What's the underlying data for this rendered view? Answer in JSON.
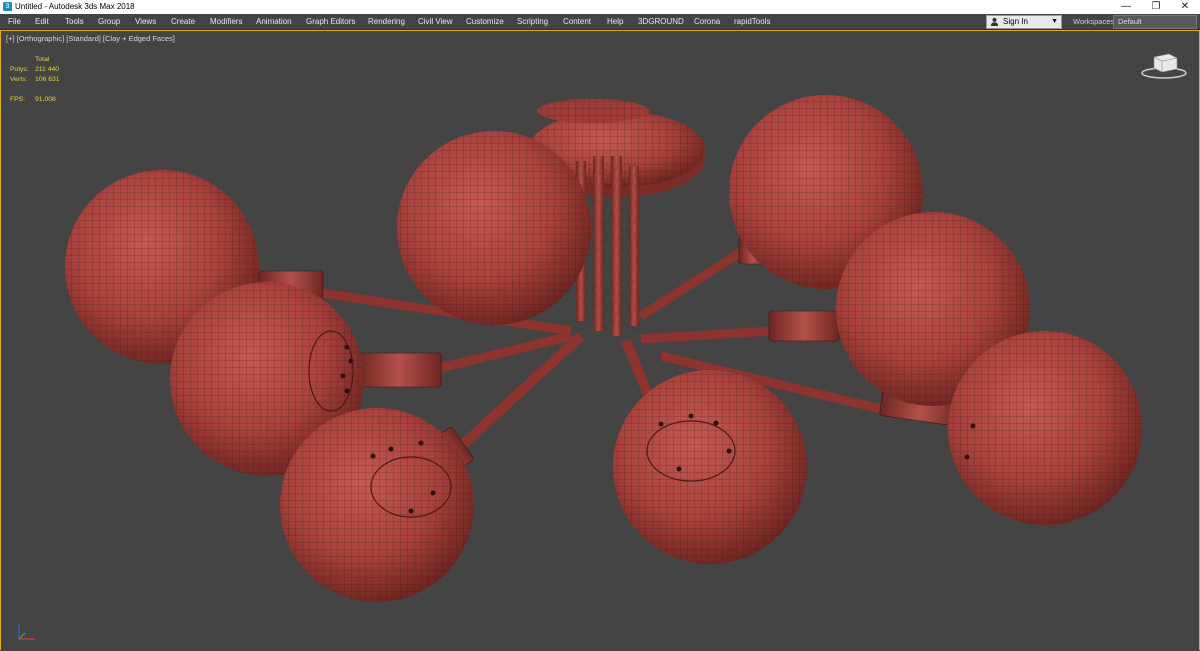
{
  "window": {
    "title": "Untitled - Autodesk 3ds Max 2018",
    "minimize": "—",
    "restore": "❐",
    "close": "✕"
  },
  "menu": [
    "File",
    "Edit",
    "Tools",
    "Group",
    "Views",
    "Create",
    "Modifiers",
    "Animation",
    "Graph Editors",
    "Rendering",
    "Civil View",
    "Customize",
    "Scripting",
    "Content",
    "Help",
    "3DGROUND",
    "Corona",
    "rapidTools"
  ],
  "account": {
    "sign_in": "Sign In"
  },
  "workspaces": {
    "label": "Workspaces:",
    "value": "Default"
  },
  "viewport": {
    "label": "[+] [Orthographic] [Standard] [Clay + Edged Faces]",
    "stats": {
      "total_label": "Total",
      "polys_label": "Polys:",
      "polys_value": "211 440",
      "verts_label": "Verts:",
      "verts_value": "106 631",
      "fps_label": "FPS:",
      "fps_value": "91,008"
    }
  },
  "colors": {
    "model": "#a8413c",
    "wire": "#3a1512",
    "viewport_bg": "#444444",
    "active_border": "#e0b020",
    "stats_text": "#e6d23a"
  }
}
